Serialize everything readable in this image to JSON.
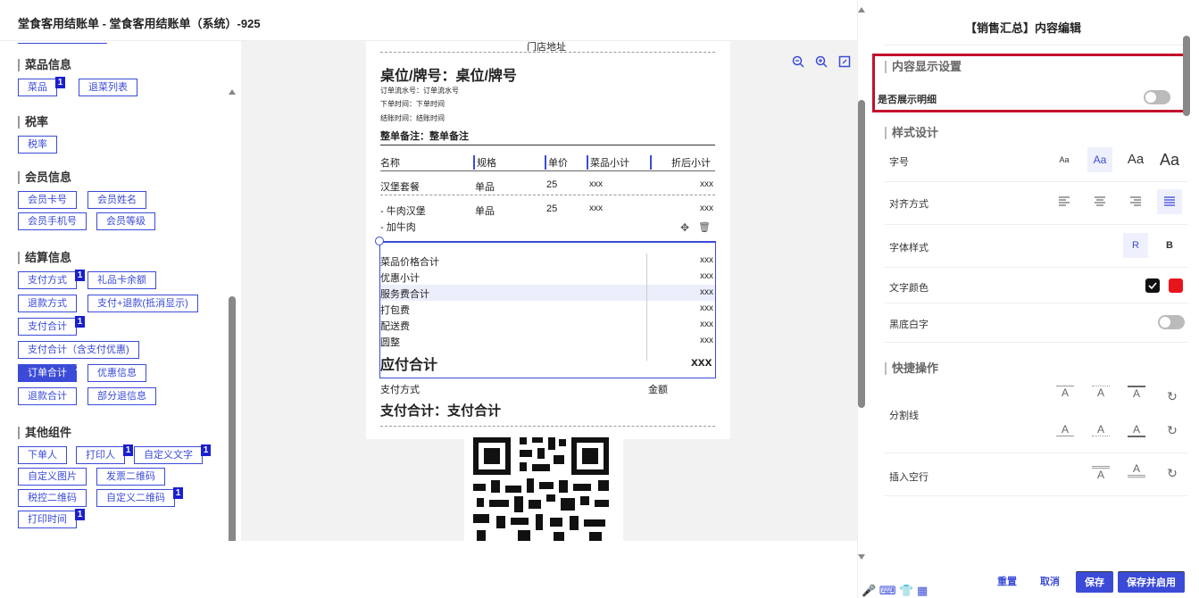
{
  "window": {
    "title": "堂食客用结账单 - 堂食客用结账单（系统）-925"
  },
  "left_panel": {
    "groups": [
      {
        "title": "菜品信息",
        "chips": [
          {
            "label": "菜品",
            "badge": "1"
          },
          {
            "label": "退菜列表",
            "badge": ""
          }
        ]
      },
      {
        "title": "税率",
        "chips": [
          {
            "label": "税率",
            "badge": ""
          }
        ]
      },
      {
        "title": "会员信息",
        "chips": [
          {
            "label": "会员卡号",
            "badge": ""
          },
          {
            "label": "会员姓名",
            "badge": ""
          },
          {
            "label": "会员手机号",
            "badge": ""
          },
          {
            "label": "会员等级",
            "badge": ""
          }
        ]
      },
      {
        "title": "结算信息",
        "chips": [
          {
            "label": "支付方式",
            "badge": "1"
          },
          {
            "label": "礼品卡余额",
            "badge": ""
          },
          {
            "label": "退款方式",
            "badge": ""
          },
          {
            "label": "支付+退款(抵消显示)",
            "badge": ""
          },
          {
            "label": "支付合计",
            "badge": "1"
          },
          {
            "label": "支付合计（含支付优惠)",
            "badge": ""
          },
          {
            "label": "订单合计",
            "badge": "2"
          },
          {
            "label": "优惠信息",
            "badge": ""
          },
          {
            "label": "退款合计",
            "badge": ""
          },
          {
            "label": "部分退信息",
            "badge": ""
          }
        ]
      },
      {
        "title": "其他组件",
        "chips": [
          {
            "label": "下单人",
            "badge": ""
          },
          {
            "label": "打印人",
            "badge": "1"
          },
          {
            "label": "自定义文字",
            "badge": "1"
          },
          {
            "label": "自定义图片",
            "badge": ""
          },
          {
            "label": "发票二维码",
            "badge": ""
          },
          {
            "label": "税控二维码",
            "badge": ""
          },
          {
            "label": "自定义二维码",
            "badge": "1"
          },
          {
            "label": "打印时间",
            "badge": "1"
          }
        ]
      }
    ]
  },
  "receipt": {
    "store_address": "门店地址",
    "table_title": "桌位/牌号：桌位/牌号",
    "serial": "订单流水号：订单流水号",
    "order_time": "下单时间：下单时间",
    "checkout_time": "结账时间：结账时间",
    "remark": "整单备注：整单备注",
    "columns": [
      "名称",
      "规格",
      "单价",
      "菜品小计",
      "折后小计"
    ],
    "items": [
      {
        "name": "汉堡套餐",
        "spec": "单品",
        "price": "25",
        "subtotal": "xxx",
        "discounted": "xxx"
      },
      {
        "name": "- 牛肉汉堡",
        "spec": "单品",
        "price": "25",
        "subtotal": "xxx",
        "discounted": "xxx"
      }
    ],
    "addon": "- 加牛肉",
    "summary": [
      {
        "label": "菜品价格合计",
        "value": "xxx"
      },
      {
        "label": "优惠小计",
        "value": "xxx"
      },
      {
        "label": "服务费合计",
        "value": "xxx"
      },
      {
        "label": "打包费",
        "value": "xxx"
      },
      {
        "label": "配送费",
        "value": "xxx"
      },
      {
        "label": "圆整",
        "value": "xxx"
      }
    ],
    "due_label": "应付合计",
    "due_value": "xxx",
    "pay_method_label": "支付方式",
    "amount_label": "金额",
    "pay_total": "支付合计：支付合计"
  },
  "right_panel": {
    "title": "【销售汇总】内容编辑",
    "display_section": "内容显示设置",
    "show_detail_label": "是否展示明细",
    "style_section": "样式设计",
    "font_size_label": "字号",
    "font_sizes": [
      "Aa",
      "Aa",
      "Aa",
      "Aa"
    ],
    "align_label": "对齐方式",
    "font_style_label": "字体样式",
    "font_style_options": [
      "R",
      "B"
    ],
    "text_color_label": "文字颜色",
    "inverse_label": "黑底白字",
    "quick_section": "快捷操作",
    "divider_label": "分割线",
    "insert_blank_label": "插入空行",
    "sep_glyph": "A",
    "buttons": {
      "reset": "重置",
      "cancel": "取消",
      "save": "保存",
      "save_enable": "保存并启用"
    }
  },
  "colors": {
    "accent": "#3b4bd8",
    "highlight": "#c3102c",
    "swatch_black": "#111111",
    "swatch_red": "#e8141c"
  }
}
